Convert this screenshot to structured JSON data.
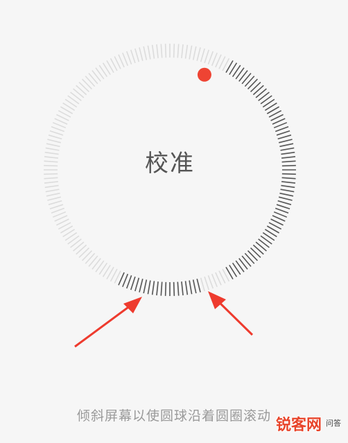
{
  "dial": {
    "label": "校准",
    "tick_count": 180,
    "progress_arcs": [
      [
        30,
        150
      ],
      [
        165,
        205
      ]
    ],
    "ball_angle": 20
  },
  "instruction": "倾斜屏幕以使圆球沿着圆圈滚动",
  "watermark": {
    "logo": "锐客网",
    "sub": "问答"
  },
  "colors": {
    "tick_inactive": "#dcdcdc",
    "tick_active": "#555555",
    "ball": "#ee4433",
    "arrow": "#ee3b2e"
  }
}
